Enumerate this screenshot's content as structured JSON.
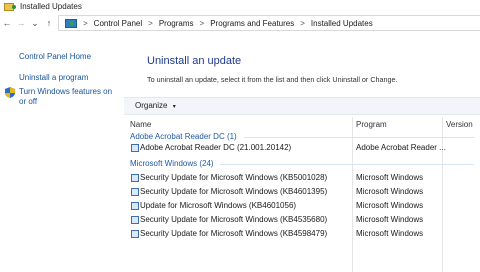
{
  "window": {
    "title": "Installed Updates"
  },
  "address": {
    "nav": {
      "back": "←",
      "forward": "→",
      "dropdown": "⌄",
      "up": "↑"
    },
    "breadcrumbs": [
      "Control Panel",
      "Programs",
      "Programs and Features",
      "Installed Updates"
    ],
    "separator": ">"
  },
  "sidebar": {
    "links": [
      "Control Panel Home",
      "Uninstall a program",
      "Turn Windows features on or off"
    ]
  },
  "main": {
    "title": "Uninstall an update",
    "description": "To uninstall an update, select it from the list and then click Uninstall or Change.",
    "toolbar": {
      "organize_label": "Organize",
      "organize_arrow": "▾"
    },
    "columns": [
      "Name",
      "Program",
      "Version"
    ],
    "groups": [
      {
        "label": "Adobe Acrobat Reader DC (1)",
        "items": [
          {
            "name": "Adobe Acrobat Reader DC  (21.001.20142)",
            "program": "Adobe Acrobat Reader ..."
          }
        ]
      },
      {
        "label": "Microsoft Windows (24)",
        "items": [
          {
            "name": "Security Update for Microsoft Windows (KB5001028)",
            "program": "Microsoft Windows"
          },
          {
            "name": "Security Update for Microsoft Windows (KB4601395)",
            "program": "Microsoft Windows"
          },
          {
            "name": "Update for Microsoft Windows (KB4601056)",
            "program": "Microsoft Windows"
          },
          {
            "name": "Security Update for Microsoft Windows (KB4535680)",
            "program": "Microsoft Windows"
          },
          {
            "name": "Security Update for Microsoft Windows (KB4598479)",
            "program": "Microsoft Windows"
          }
        ]
      }
    ]
  },
  "colors": {
    "link": "#1a56a0",
    "heading": "#1e3a8a",
    "group": "#1f5aa3"
  }
}
